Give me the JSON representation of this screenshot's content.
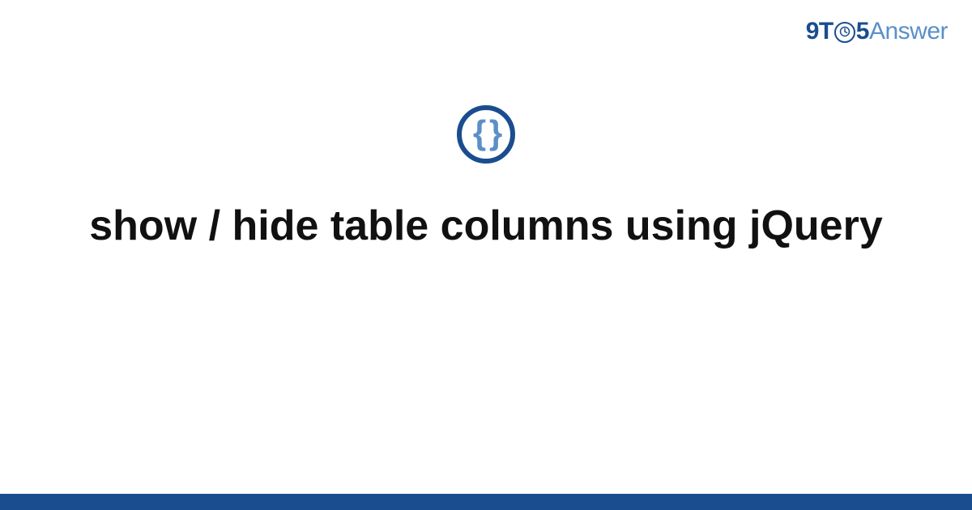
{
  "logo": {
    "part1": "9T",
    "clock_glyph": "⏱",
    "part2": "5",
    "part3": "Answer"
  },
  "badge": {
    "glyph": "{ }"
  },
  "title": "show / hide table columns using jQuery",
  "colors": {
    "brand_dark": "#1a4d8f",
    "brand_light": "#5b8fc7"
  }
}
